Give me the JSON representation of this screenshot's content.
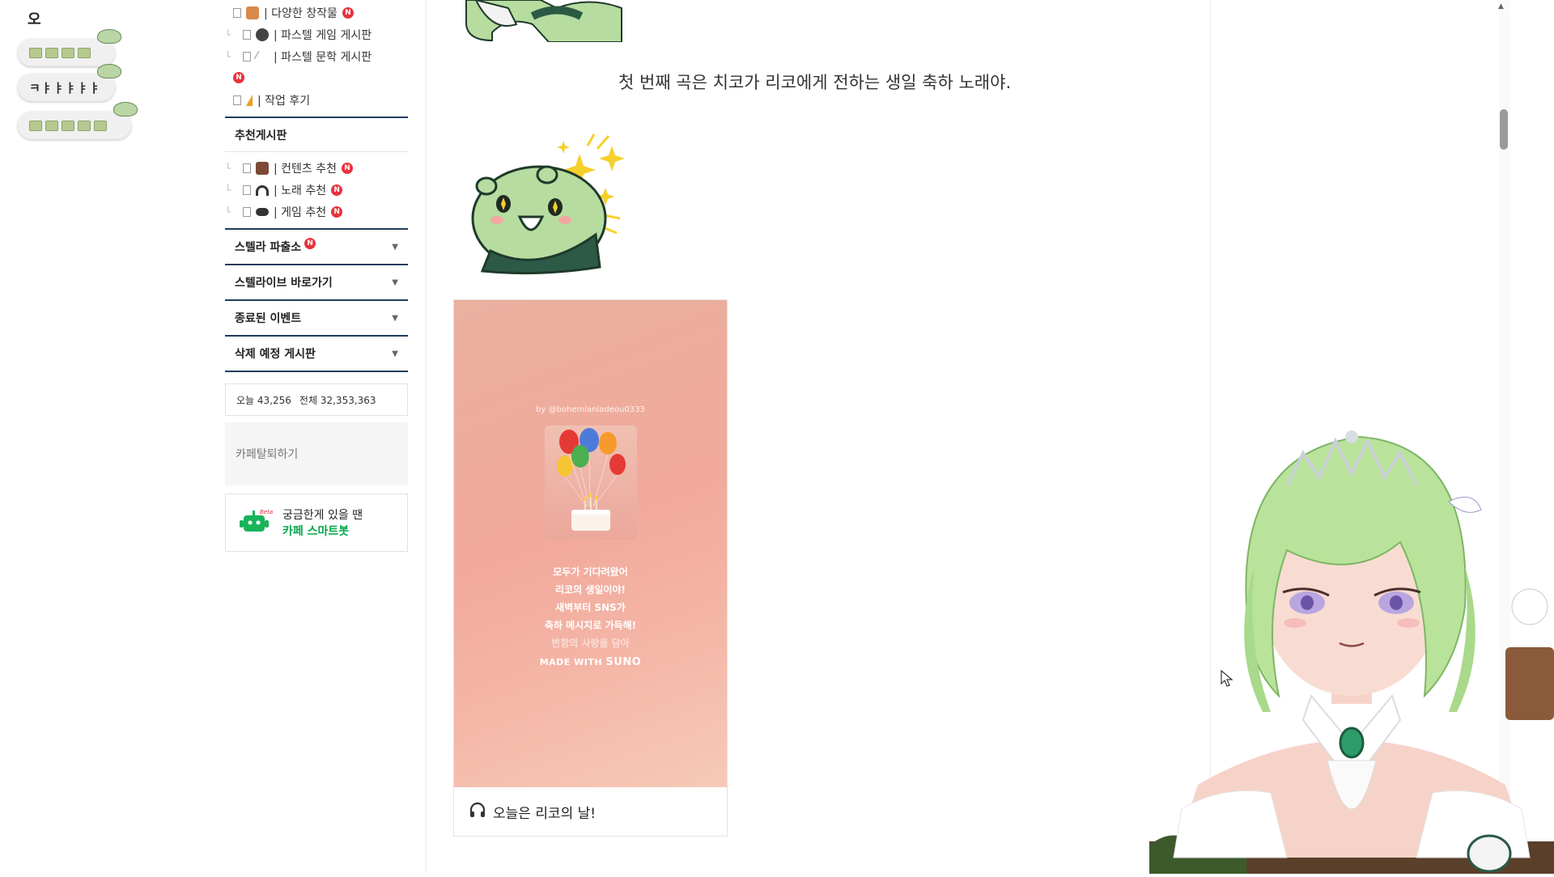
{
  "chat": {
    "top_char": "오",
    "messages": [
      {
        "type": "emote",
        "count": 4
      },
      {
        "type": "text",
        "text": "ㅋㅑㅑㅑㅑㅑ"
      },
      {
        "type": "emote",
        "count": 5
      }
    ]
  },
  "menu": {
    "items_top": [
      {
        "label": "| 다양한 창작물",
        "icon": "costume-icon",
        "new": true
      },
      {
        "label": "| 파스텔 게임 게시판",
        "icon": "gamer-icon",
        "new": false
      },
      {
        "label": "| 파스텔 문학 게시판",
        "icon": "pen-icon",
        "new": true
      },
      {
        "label": "| 작업 후기",
        "icon": "ruler-icon",
        "new": false
      }
    ],
    "section_recommend": "추천게시판",
    "items_recommend": [
      {
        "label": "| 컨텐츠 추천",
        "icon": "signboard-icon",
        "new": true
      },
      {
        "label": "| 노래 추천",
        "icon": "headphones-icon",
        "new": true
      },
      {
        "label": "| 게임 추천",
        "icon": "gamepad-icon",
        "new": true
      }
    ],
    "collapsed_sections": [
      {
        "label": "스텔라 파출소",
        "new": true
      },
      {
        "label": "스텔라이브 바로가기",
        "new": false
      },
      {
        "label": "종료된 이벤트",
        "new": false
      },
      {
        "label": "삭제 예정 게시판",
        "new": false
      }
    ],
    "new_badge": "N",
    "stats": {
      "today_label": "오늘",
      "today": "43,256",
      "total_label": "전체",
      "total": "32,353,363"
    },
    "leave_label": "카페탈퇴하기",
    "bot": {
      "badge": "Beta",
      "line1": "궁금한게 있을 땐",
      "line2": "카페 스마트봇"
    }
  },
  "article": {
    "text": "첫 번째 곡은 치코가 리코에게 전하는 생일 축하 노래야.",
    "card": {
      "by": "by @bohemianladeou0333",
      "lines": [
        "모두가 기다려왔어",
        "리코의 생일이야!",
        "새벽부터 SNS가",
        "축하 메시지로 가득해!",
        "변함의 사랑을 담아"
      ],
      "made_with": "MADE WITH",
      "made_brand": "SUNO",
      "title": "오늘은 리코의 날!"
    }
  },
  "colors": {
    "menu_line": "#1f3b5c",
    "new_badge": "#e8323c",
    "bot_green": "#03a64a"
  }
}
